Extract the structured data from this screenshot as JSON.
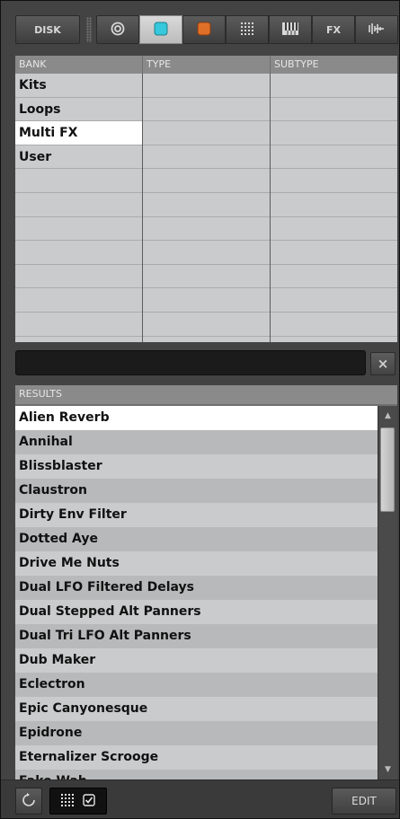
{
  "toolbar": {
    "disk_label": "DISK",
    "tabs": [
      {
        "icon": "target-icon",
        "label": ""
      },
      {
        "icon": "cyan-square-icon",
        "color": "#36c8dc"
      },
      {
        "icon": "orange-square-icon",
        "color": "#e07028"
      },
      {
        "icon": "pads-grid-icon",
        "label": ""
      },
      {
        "icon": "keyboard-icon",
        "label": ""
      },
      {
        "icon": "fx-icon",
        "label": "FX"
      },
      {
        "icon": "waveform-icon",
        "label": ""
      }
    ]
  },
  "filter": {
    "headers": {
      "bank": "BANK",
      "type": "TYPE",
      "subtype": "SUBTYPE"
    },
    "banks": [
      "Kits",
      "Loops",
      "Multi FX",
      "User"
    ],
    "selected_bank": "Multi FX"
  },
  "search": {
    "value": "",
    "clear_label": "×"
  },
  "results": {
    "header": "RESULTS",
    "selected": "Alien Reverb",
    "items": [
      "Alien Reverb",
      "Annihal",
      "Blissblaster",
      "Claustron",
      "Dirty Env Filter",
      "Dotted Aye",
      "Drive Me Nuts",
      "Dual LFO Filtered Delays",
      "Dual Stepped Alt Panners",
      "Dual Tri LFO Alt Panners",
      "Dub Maker",
      "Eclectron",
      "Epic Canyonesque",
      "Epidrone",
      "Eternalizer Scrooge",
      "Fake Wah"
    ]
  },
  "footer": {
    "edit_label": "EDIT"
  },
  "colors": {
    "accent_cyan": "#36c8dc",
    "accent_orange": "#e07028"
  }
}
